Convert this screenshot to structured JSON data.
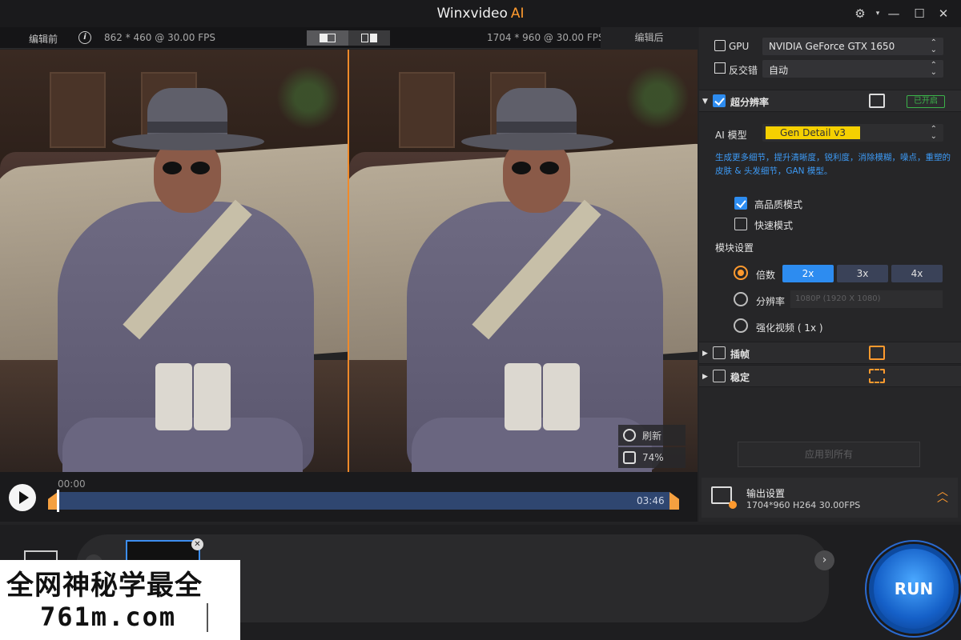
{
  "app": {
    "title": "Winxvideo",
    "title_accent": "AI"
  },
  "window": {
    "settings_icon": "gear-icon",
    "minimize": "—",
    "maximize": "☐",
    "close": "✕"
  },
  "preview": {
    "before_label": "编辑前",
    "before_info": "862 * 460 @ 30.00 FPS",
    "after_info_res": "1704 * 960",
    "after_info_fps": " @ 30.00 FPS",
    "after_label": "编辑后",
    "refresh_label": "刷新",
    "zoom_label": "74%"
  },
  "timeline": {
    "start": "00:00",
    "end": "03:46",
    "progress": 0.0
  },
  "panel": {
    "gpu_label": "GPU",
    "gpu_value": "NVIDIA GeForce GTX 1650",
    "deinterlace_label": "反交错",
    "deinterlace_value": "自动",
    "superres_label": "超分辨率",
    "superres_badge": "已开启",
    "model_label": "AI 模型",
    "model_value": "Gen Detail v3",
    "model_desc": "生成更多细节，提升清晰度，锐利度，消除模糊，噪点，重塑的皮肤 & 头发细节，GAN 模型。",
    "hq_mode": "高品质模式",
    "fast_mode": "快速模式",
    "mode_settings": "模块设置",
    "scale_label": "倍数",
    "scale_options": [
      "2x",
      "3x",
      "4x"
    ],
    "res_label": "分辨率",
    "res_value": "1080P (1920 X 1080)",
    "enhance_label": "强化视频 ( 1x )",
    "interp_label": "插帧",
    "stab_label": "稳定",
    "apply_all": "应用到所有"
  },
  "output": {
    "title": "输出设置",
    "meta": "1704*960   H264   30.00FPS"
  },
  "run_label": "RUN",
  "watermark": {
    "line1": "全网神秘学最全",
    "line2": "761m.com"
  },
  "colors": {
    "accent": "#ff9a2e",
    "blue": "#2d8cf0",
    "green": "#3bb34a"
  }
}
